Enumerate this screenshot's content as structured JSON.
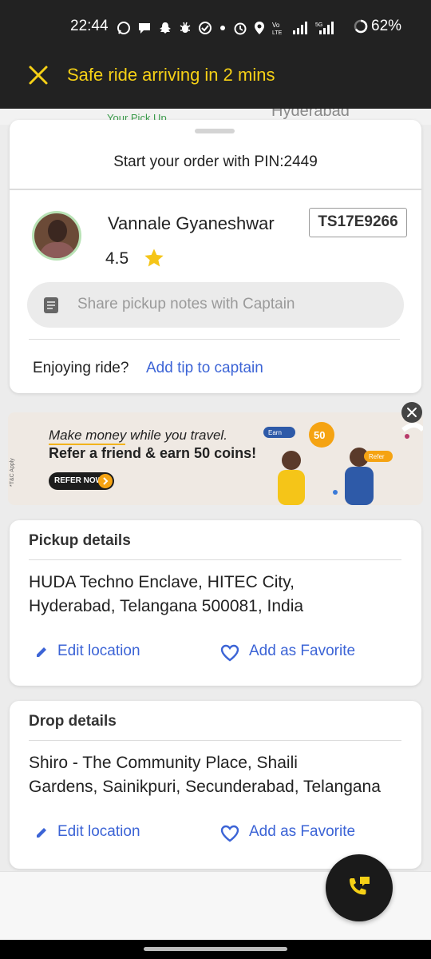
{
  "status_bar": {
    "time": "22:44",
    "battery": "62%",
    "icons": [
      "whatsapp-icon",
      "chat-icon",
      "snapchat-icon",
      "bug-icon",
      "check-icon",
      "dot-icon",
      "alarm-icon",
      "location-icon",
      "volte-icon",
      "signal-icon",
      "5g-signal-icon",
      "battery-icon"
    ]
  },
  "banner": {
    "text": "Safe ride arriving in 2 mins",
    "accent_color": "#f5d016"
  },
  "map": {
    "pickup_label": "Your Pick Up",
    "city_label": "Hyderabad"
  },
  "driver_card": {
    "pin_text": "Start your order with PIN:2449",
    "driver_name": "Vannale Gyaneshwar",
    "rating": "4.5",
    "plate": "TS17E9266",
    "notes_placeholder": "Share pickup notes with Captain",
    "enjoy_text": "Enjoying ride?",
    "tip_link": "Add tip to captain"
  },
  "promo": {
    "line1": "Make money while you travel.",
    "line2": "Refer a friend & earn 50 coins!",
    "button": "REFER NOW",
    "tc": "*T&C Apply",
    "earn_tag": "Earn",
    "coins": "50",
    "refer_tag": "Refer"
  },
  "pickup": {
    "title": "Pickup details",
    "address_lines": [
      "HUDA Techno Enclave, HITEC City,",
      "Hyderabad, Telangana 500081, India"
    ],
    "edit": "Edit location",
    "favorite": "Add as Favorite"
  },
  "drop": {
    "title": "Drop details",
    "address_lines": [
      "Shiro - The Community Place, Shaili",
      "Gardens, Sainikpuri, Secunderabad, Telangana"
    ],
    "edit": "Edit location",
    "favorite": "Add as Favorite"
  },
  "colors": {
    "link": "#3c64d6",
    "star": "#f5c518",
    "call_icon": "#f5d016"
  }
}
